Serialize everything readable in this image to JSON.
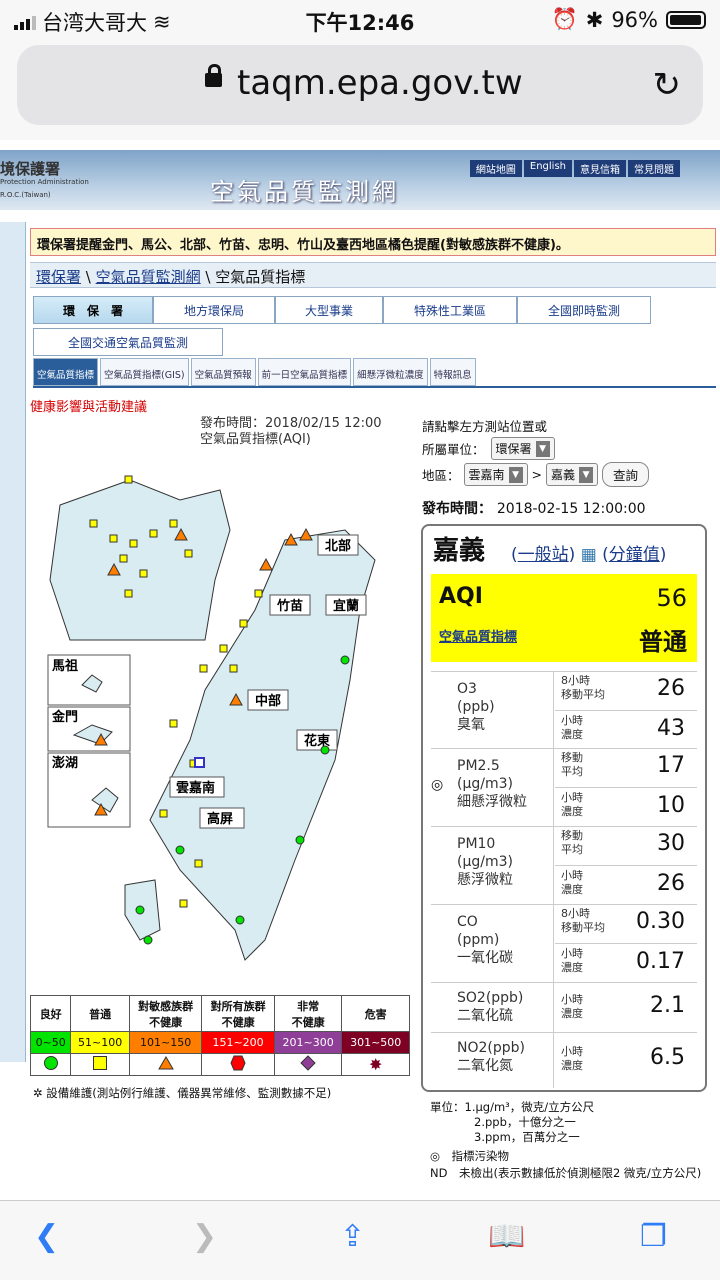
{
  "status": {
    "carrier": "台湾大哥大",
    "time": "下午12:46",
    "battery": "96%",
    "battery_level": 0.96
  },
  "browser": {
    "url": "taqm.epa.gov.tw"
  },
  "banner": {
    "logo_line1": "境保護署",
    "logo_line2": "Protection Administration",
    "logo_line3": "R.O.C.(Taiwan)",
    "title": "空氣品質監測網",
    "links": [
      "網站地圖",
      "English",
      "意見信箱",
      "常見問題"
    ]
  },
  "alert": "環保署提醒金門、馬公、北部、竹苗、忠明、竹山及臺西地區橘色提醒(對敏感族群不健康)。",
  "breadcrumb": [
    "環保署",
    "空氣品質監測網",
    "空氣品質指標"
  ],
  "nav_row1": [
    "環　保　署",
    "地方環保局",
    "大型事業",
    "特殊性工業區",
    "全國即時監測"
  ],
  "nav_row2": [
    "全國交通空氣品質監測"
  ],
  "tabs": [
    "空氣品質指標",
    "空氣品質指標(GIS)",
    "空氣品質預報",
    "前一日空氣品質指標",
    "細懸浮微粒濃度",
    "特報訊息"
  ],
  "health_link": "健康影響與活動建議",
  "map": {
    "pub_time": "發布時間：2018/02/15 12:00",
    "subtitle": "空氣品質指標(AQI)",
    "regions": [
      "北部",
      "竹苗",
      "宜蘭",
      "中部",
      "花東",
      "雲嘉南",
      "高屏",
      "馬祖",
      "金門",
      "澎湖"
    ]
  },
  "legend": {
    "headers": [
      "良好",
      "普通",
      "對敏感族群\n不健康",
      "對所有族群\n不健康",
      "非常\n不健康",
      "危害"
    ],
    "ranges": [
      "0~50",
      "51~100",
      "101~150",
      "151~200",
      "201~300",
      "301~500"
    ],
    "colors": [
      "#00e400",
      "#ffff00",
      "#ff7e00",
      "#ff0000",
      "#8f3f97",
      "#7e0023"
    ]
  },
  "maintenance": "設備維護(測站例行維護、儀器異常維修、監測數據不足)",
  "panel": {
    "hint": "請點擊左方測站位置或",
    "unit_label": "所屬單位：",
    "unit_value": "環保署",
    "area_label": "地區：",
    "area_value": "雲嘉南",
    "site_value": "嘉義",
    "query": "查詢",
    "time_label": "發布時間：",
    "time_value": "2018-02-15 12:00:00",
    "site": "嘉義",
    "site_type": "一般站",
    "minute": "分鐘值",
    "aqi_label": "AQI",
    "aqi_value": "56",
    "aqi_sub": "空氣品質指標",
    "aqi_status": "普通",
    "pollutants": [
      {
        "name": "O3",
        "unit": "(ppb)",
        "cname": "臭氧",
        "r1l": "8小時",
        "r1l2": "移動平均",
        "r1v": "26",
        "r2l": "小時",
        "r2l2": "濃度",
        "r2v": "43"
      },
      {
        "name": "PM2.5",
        "unit": "(μg/m3)",
        "cname": "細懸浮微粒",
        "r1l": "移動",
        "r1l2": "平均",
        "r1v": "17",
        "r2l": "小時",
        "r2l2": "濃度",
        "r2v": "10"
      },
      {
        "name": "PM10",
        "unit": "(μg/m3)",
        "cname": "懸浮微粒",
        "r1l": "移動",
        "r1l2": "平均",
        "r1v": "30",
        "r2l": "小時",
        "r2l2": "濃度",
        "r2v": "26"
      },
      {
        "name": "CO",
        "unit": "(ppm)",
        "cname": "一氧化碳",
        "r1l": "8小時",
        "r1l2": "移動平均",
        "r1v": "0.30",
        "r2l": "小時",
        "r2l2": "濃度",
        "r2v": "0.17"
      },
      {
        "name": "SO2(ppb)",
        "unit": "",
        "cname": "二氧化硫",
        "r1l": "小時",
        "r1l2": "濃度",
        "r1v": "2.1"
      },
      {
        "name": "NO2(ppb)",
        "unit": "",
        "cname": "二氧化氮",
        "r1l": "小時",
        "r1l2": "濃度",
        "r1v": "6.5"
      }
    ]
  },
  "notes": {
    "unit_label": "單位：",
    "u1": "1.μg/m³，微克/立方公尺",
    "u2": "2.ppb，十億分之一",
    "u3": "3.ppm，百萬分之一",
    "mark": "◎　指標污染物",
    "nd": "ND　未檢出(表示數據低於偵測極限2 微克/立方公尺)"
  }
}
